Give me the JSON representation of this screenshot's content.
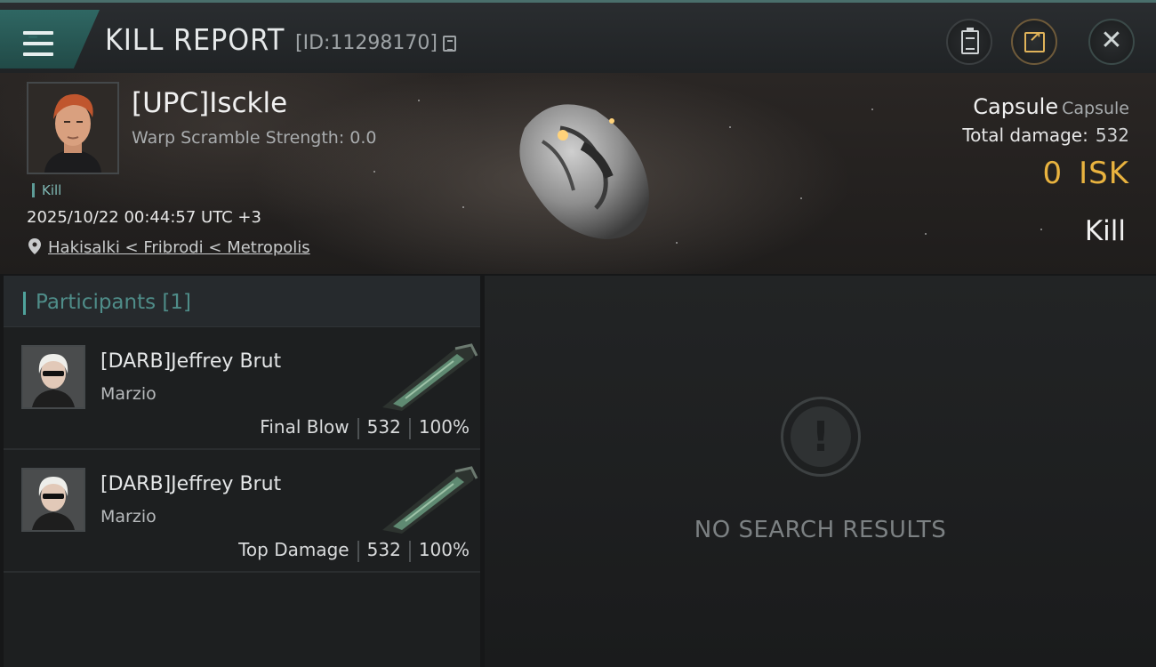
{
  "header": {
    "title": "KILL REPORT",
    "report_id": "[ID:11298170]"
  },
  "victim": {
    "name": "[UPC]Isckle",
    "warp_scramble": "Warp Scramble Strength: 0.0",
    "tag": "Kill",
    "timestamp": "2025/10/22 00:44:57 UTC +3",
    "location": "Hakisalki < Fribrodi < Metropolis"
  },
  "ship_summary": {
    "ship_name": "Capsule",
    "ship_class": "Capsule",
    "total_damage_label": "Total damage:",
    "total_damage_value": "532",
    "isk_value": "0",
    "isk_unit": "ISK",
    "result": "Kill"
  },
  "participants": {
    "title": "Participants [1]",
    "rows": [
      {
        "name": "[DARB]Jeffrey Brut",
        "ship": "Marzio",
        "role": "Final Blow",
        "damage": "532",
        "percent": "100%"
      },
      {
        "name": "[DARB]Jeffrey Brut",
        "ship": "Marzio",
        "role": "Top Damage",
        "damage": "532",
        "percent": "100%"
      }
    ]
  },
  "results_panel": {
    "empty_text": "NO SEARCH RESULTS"
  },
  "icons": {
    "menu": "menu-icon",
    "copy": "copy-icon",
    "clipboard": "clipboard-icon",
    "share": "share-icon",
    "close": "close-icon",
    "location": "location-pin-icon",
    "empty": "exclamation-icon"
  },
  "colors": {
    "accent_teal": "#4fa39c",
    "isk_gold": "#e9b33f",
    "share_gold": "#e0b35a"
  }
}
